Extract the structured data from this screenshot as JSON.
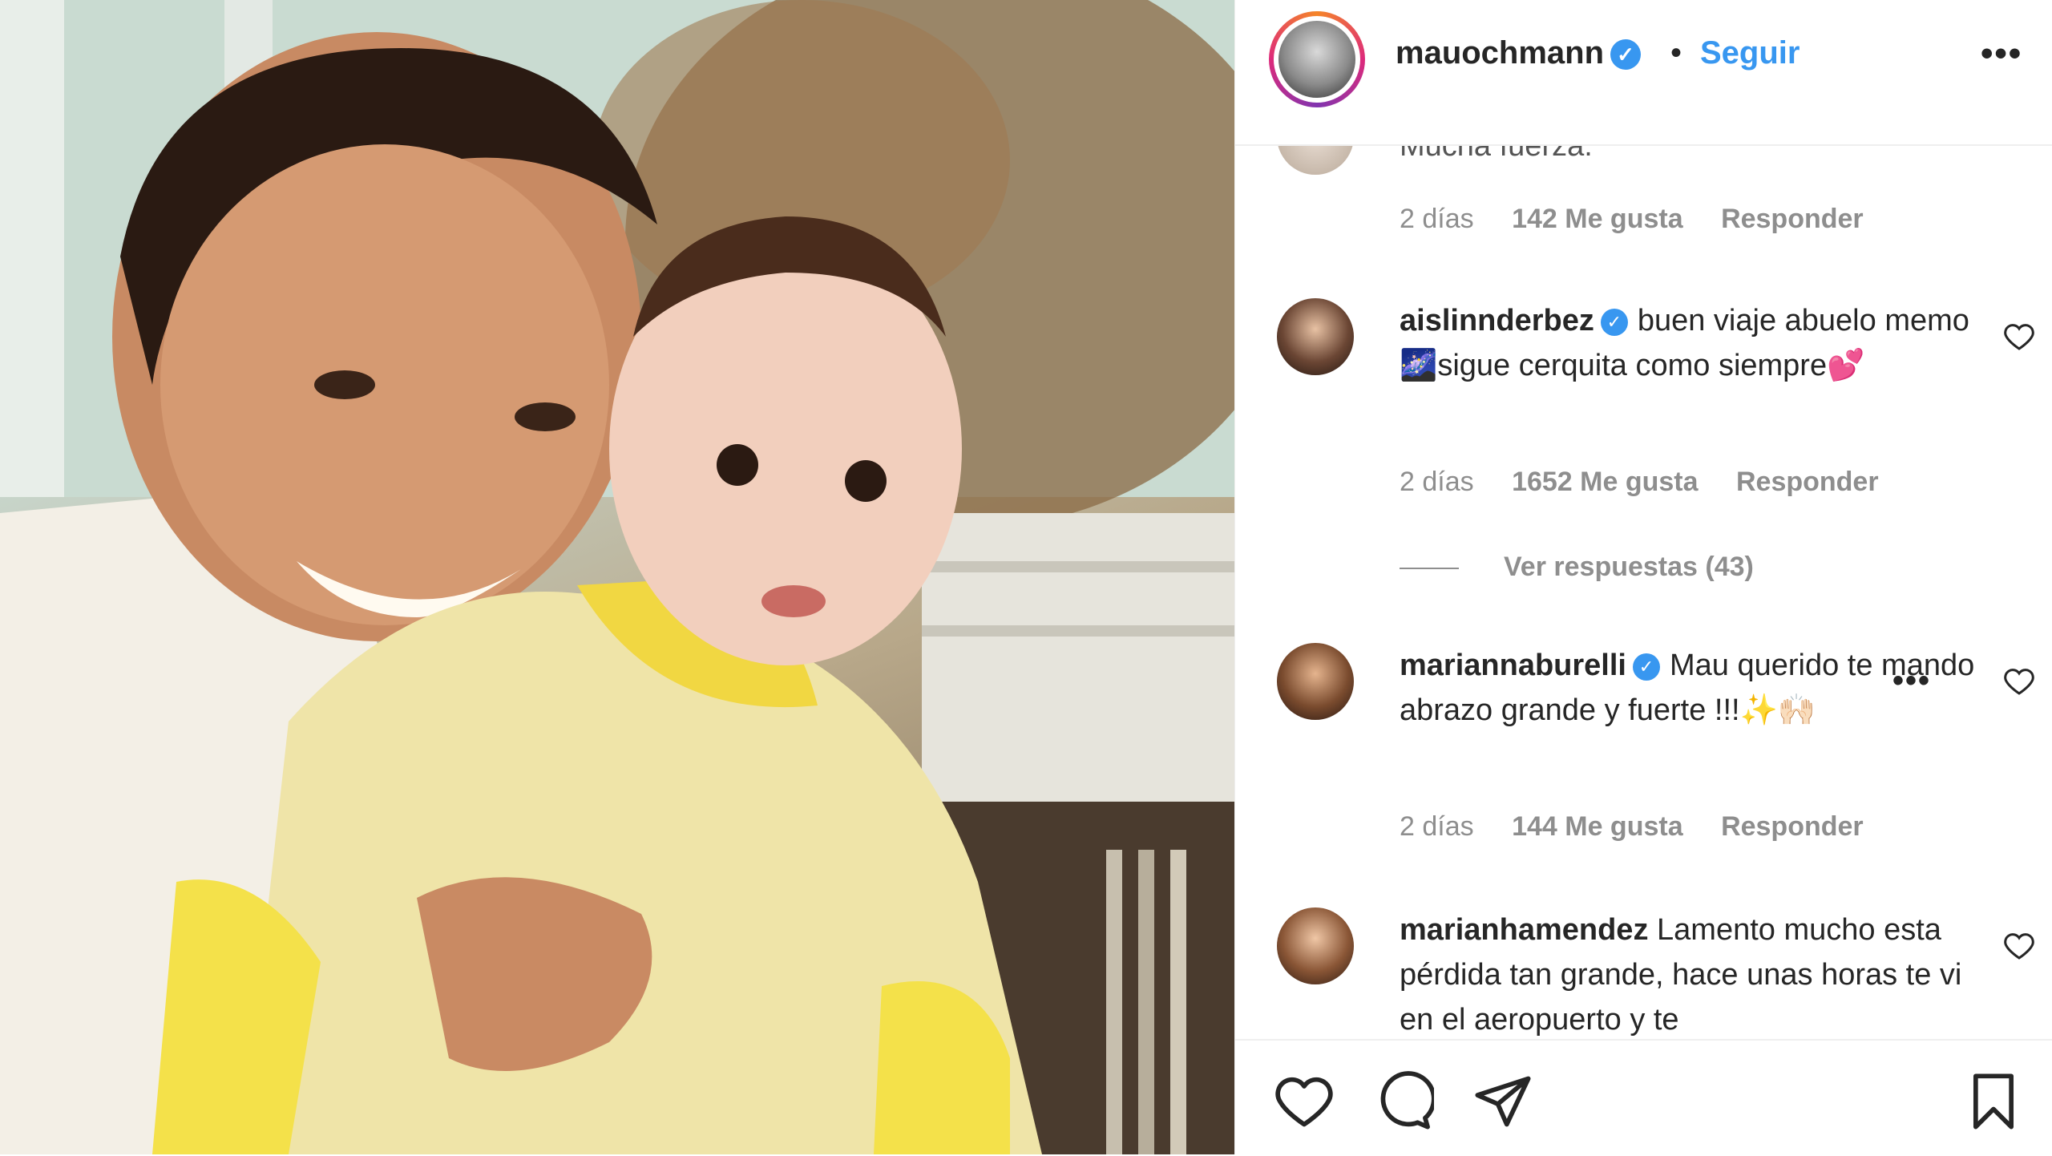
{
  "header": {
    "username": "mauochmann",
    "follow_label": "Seguir",
    "separator": "•"
  },
  "comments": [
    {
      "text": "Mucha fuerza.",
      "age": "2 días",
      "likes": "142 Me gusta",
      "reply": "Responder"
    },
    {
      "username": "aislinnderbez",
      "text": "buen viaje abuelo memo 🌌sigue cerquita como siempre💕",
      "age": "2 días",
      "likes": "1652 Me gusta",
      "reply": "Responder",
      "view_replies": "Ver respuestas (43)"
    },
    {
      "username": "mariannaburelli",
      "text": "Mau querido te mando abrazo grande y fuerte !!!✨🙌🏻",
      "age": "2 días",
      "likes": "144 Me gusta",
      "reply": "Responder"
    },
    {
      "username": "marianhamendez",
      "text": "Lamento mucho esta pérdida tan grande, hace unas horas te vi en el aeropuerto y te"
    }
  ],
  "icons": {
    "verified": "verified-badge-icon",
    "more": "more-options-icon",
    "like": "heart-icon",
    "comment": "comment-icon",
    "share": "send-icon",
    "save": "bookmark-icon"
  },
  "colors": {
    "accent": "#3897f0",
    "text": "#262626",
    "muted": "#8e8e8e"
  }
}
